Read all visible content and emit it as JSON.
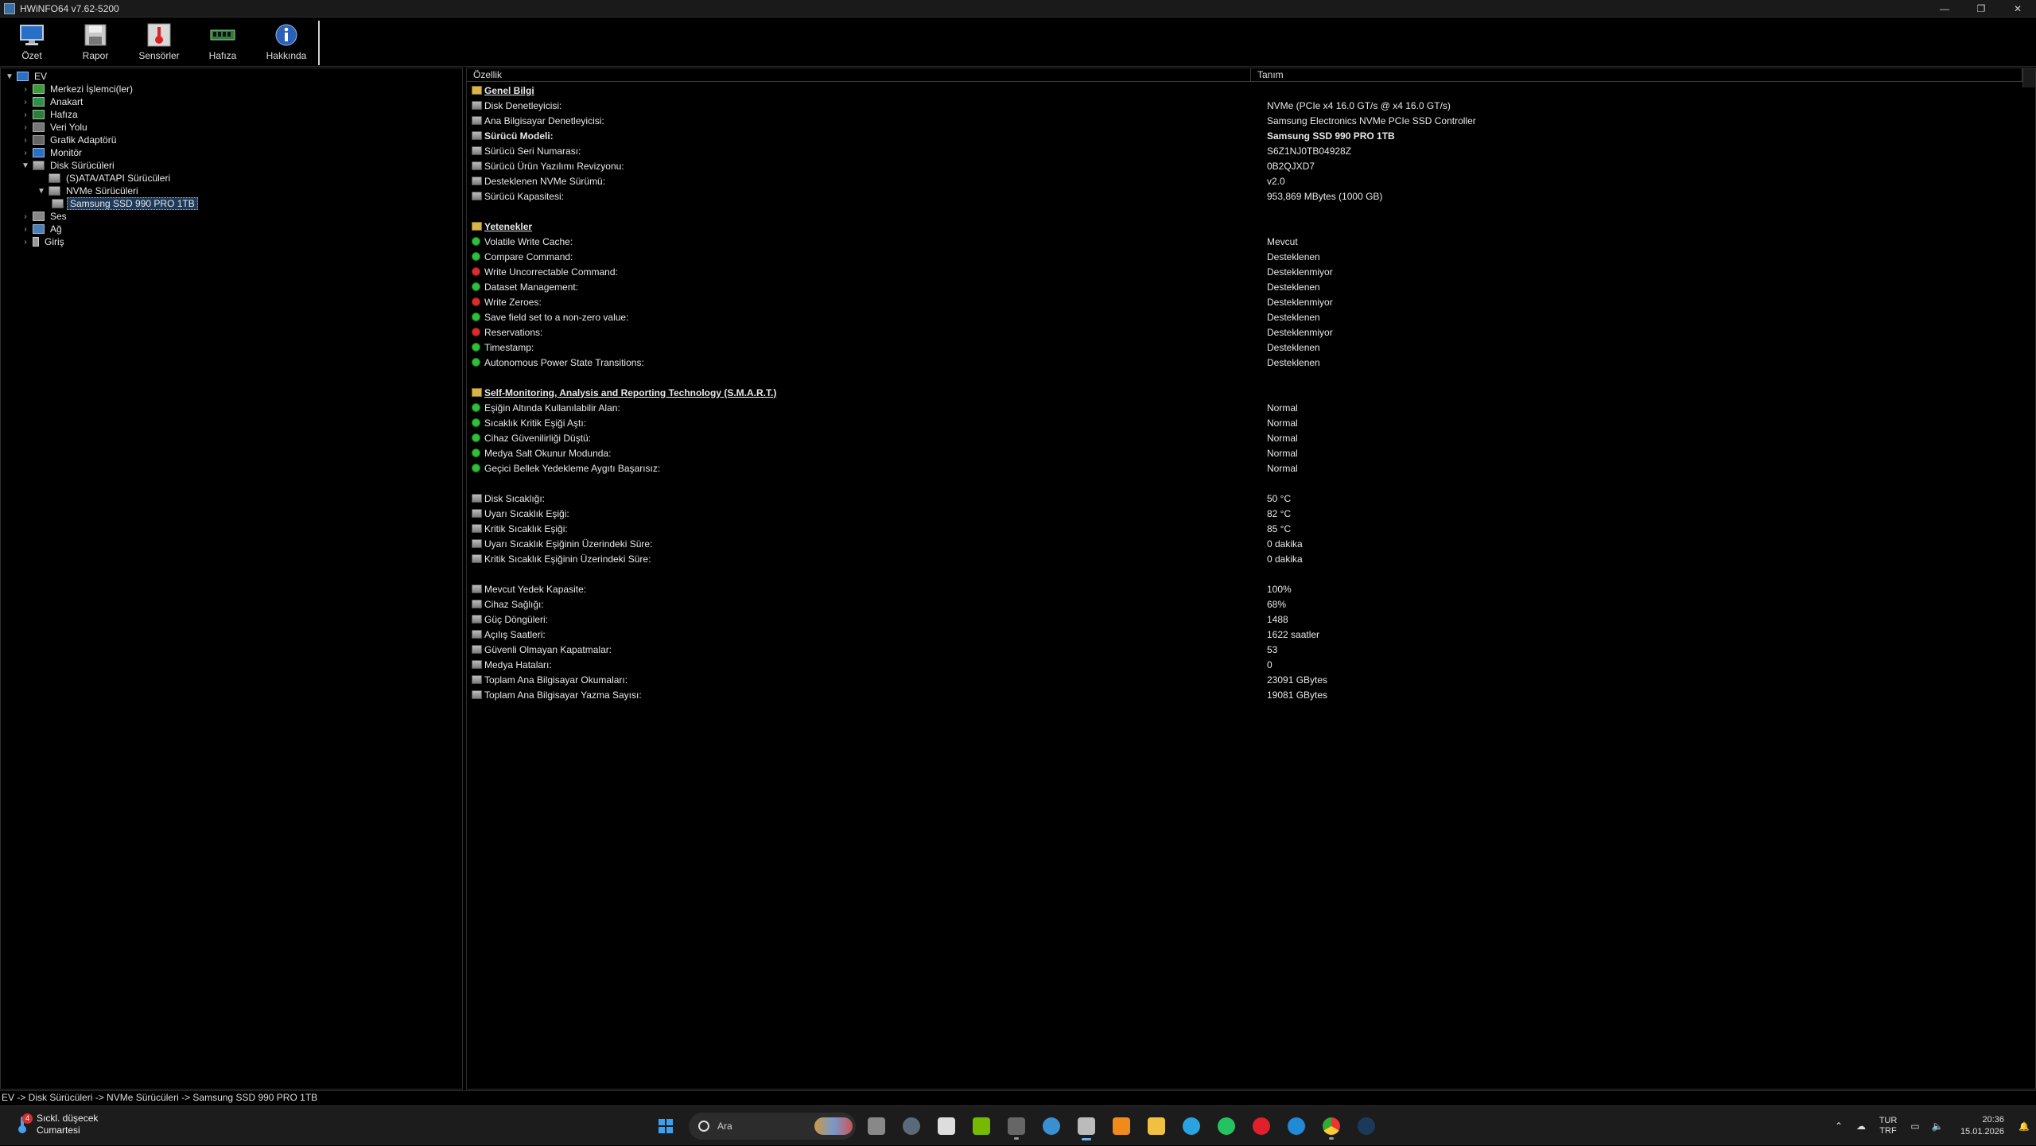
{
  "window": {
    "title": "HWiNFO64 v7.62-5200",
    "buttons": {
      "minimize": "—",
      "restore": "❐",
      "close": "✕"
    }
  },
  "toolbar": {
    "buttons": [
      {
        "label": "Özet",
        "icon": "monitor-icon"
      },
      {
        "label": "Rapor",
        "icon": "save-disk-icon"
      },
      {
        "label": "Sensörler",
        "icon": "thermometer-icon"
      },
      {
        "label": "Hafıza",
        "icon": "memory-module-icon"
      },
      {
        "label": "Hakkında",
        "icon": "info-icon"
      }
    ]
  },
  "tree": {
    "root": "EV",
    "items": [
      {
        "label": "Merkezi İşlemci(ler)"
      },
      {
        "label": "Anakart"
      },
      {
        "label": "Hafıza"
      },
      {
        "label": "Veri Yolu"
      },
      {
        "label": "Grafik Adaptörü"
      },
      {
        "label": "Monitör"
      },
      {
        "label": "Disk Sürücüleri"
      },
      {
        "label": "(S)ATA/ATAPI Sürücüleri"
      },
      {
        "label": "NVMe Sürücüleri"
      },
      {
        "label": "Samsung SSD 990 PRO 1TB"
      },
      {
        "label": "Ses"
      },
      {
        "label": "Ağ"
      },
      {
        "label": "Giriş"
      }
    ]
  },
  "columns": {
    "feature": "Özellik",
    "description": "Tanım"
  },
  "details": [
    {
      "kind": "section",
      "name": "Genel Bilgi",
      "value": ""
    },
    {
      "kind": "drive",
      "name": "Disk Denetleyicisi:",
      "value": "NVMe (PCIe x4 16.0 GT/s @ x4 16.0 GT/s)"
    },
    {
      "kind": "drive",
      "name": "Ana Bilgisayar Denetleyicisi:",
      "value": "Samsung Electronics NVMe PCIe SSD Controller",
      "link": true
    },
    {
      "kind": "drive",
      "name": "Sürücü Modeli:",
      "value": "Samsung SSD 990 PRO 1TB",
      "bold": true
    },
    {
      "kind": "drive",
      "name": "Sürücü Seri Numarası:",
      "value": "S6Z1NJ0TB04928Z"
    },
    {
      "kind": "drive",
      "name": "Sürücü Ürün Yazılımı Revizyonu:",
      "value": "0B2QJXD7"
    },
    {
      "kind": "drive",
      "name": "Desteklenen NVMe Sürümü:",
      "value": "v2.0"
    },
    {
      "kind": "drive",
      "name": "Sürücü Kapasitesi:",
      "value": "953,869 MBytes (1000 GB)"
    },
    {
      "kind": "blank",
      "name": "",
      "value": ""
    },
    {
      "kind": "section",
      "name": "Yetenekler",
      "value": ""
    },
    {
      "kind": "ok",
      "name": "Volatile Write Cache:",
      "value": "Mevcut"
    },
    {
      "kind": "ok",
      "name": "Compare Command:",
      "value": "Desteklenen"
    },
    {
      "kind": "no",
      "name": "Write Uncorrectable Command:",
      "value": "Desteklenmiyor"
    },
    {
      "kind": "ok",
      "name": "Dataset Management:",
      "value": "Desteklenen"
    },
    {
      "kind": "no",
      "name": "Write Zeroes:",
      "value": "Desteklenmiyor"
    },
    {
      "kind": "ok",
      "name": "Save field set to a non-zero value:",
      "value": "Desteklenen"
    },
    {
      "kind": "no",
      "name": "Reservations:",
      "value": "Desteklenmiyor"
    },
    {
      "kind": "ok",
      "name": "Timestamp:",
      "value": "Desteklenen"
    },
    {
      "kind": "ok",
      "name": "Autonomous Power State Transitions:",
      "value": "Desteklenen"
    },
    {
      "kind": "blank",
      "name": "",
      "value": ""
    },
    {
      "kind": "section",
      "name": "Self-Monitoring, Analysis and Reporting Technology (S.M.A.R.T.)",
      "value": ""
    },
    {
      "kind": "ok",
      "name": "Eşiğin Altında Kullanılabilir Alan:",
      "value": "Normal"
    },
    {
      "kind": "ok",
      "name": "Sıcaklık Kritik Eşiği Aştı:",
      "value": "Normal"
    },
    {
      "kind": "ok",
      "name": "Cihaz Güvenilirliği Düştü:",
      "value": "Normal"
    },
    {
      "kind": "ok",
      "name": "Medya Salt Okunur Modunda:",
      "value": "Normal"
    },
    {
      "kind": "ok",
      "name": "Geçici Bellek Yedekleme Aygıtı Başarısız:",
      "value": "Normal"
    },
    {
      "kind": "blank",
      "name": "",
      "value": ""
    },
    {
      "kind": "drive",
      "name": "Disk Sıcaklığı:",
      "value": "50 °C"
    },
    {
      "kind": "drive",
      "name": "Uyarı Sıcaklık Eşiği:",
      "value": "82 °C"
    },
    {
      "kind": "drive",
      "name": "Kritik Sıcaklık Eşiği:",
      "value": "85 °C"
    },
    {
      "kind": "drive",
      "name": "Uyarı Sıcaklık Eşiğinin Üzerindeki Süre:",
      "value": "0 dakika"
    },
    {
      "kind": "drive",
      "name": "Kritik Sıcaklık Eşiğinin Üzerindeki Süre:",
      "value": "0 dakika"
    },
    {
      "kind": "blank",
      "name": "",
      "value": ""
    },
    {
      "kind": "drive",
      "name": "Mevcut Yedek Kapasite:",
      "value": "100%"
    },
    {
      "kind": "drive",
      "name": "Cihaz Sağlığı:",
      "value": "68%"
    },
    {
      "kind": "drive",
      "name": "Güç Döngüleri:",
      "value": "1488"
    },
    {
      "kind": "drive",
      "name": "Açılış Saatleri:",
      "value": "1622 saatler"
    },
    {
      "kind": "drive",
      "name": "Güvenli Olmayan Kapatmalar:",
      "value": "53"
    },
    {
      "kind": "drive",
      "name": "Medya Hataları:",
      "value": "0"
    },
    {
      "kind": "drive",
      "name": "Toplam Ana Bilgisayar Okumaları:",
      "value": "23091 GBytes"
    },
    {
      "kind": "drive",
      "name": "Toplam Ana Bilgisayar Yazma Sayısı:",
      "value": "19081 GBytes"
    }
  ],
  "statusbar": {
    "path": "EV -> Disk Sürücüleri -> NVMe Sürücüleri -> Samsung SSD 990 PRO 1TB"
  },
  "taskbar": {
    "weather": {
      "line1": "Sıckl. düşecek",
      "line2": "Cumartesi",
      "badge": "4"
    },
    "search_placeholder": "Ara",
    "apps": [
      "file-explorer-icon",
      "settings-icon",
      "store-icon",
      "nvidia-icon",
      "app-icon",
      "gear-icon",
      "hwinfo-icon",
      "orange-app-icon",
      "folder-icon",
      "telegram-icon",
      "whatsapp-icon",
      "opera-icon",
      "edge-icon",
      "chrome-icon",
      "steam-icon"
    ],
    "tray": {
      "lang1": "TUR",
      "lang2": "TRF",
      "time": "20:36",
      "date": "15.01.2026"
    }
  },
  "colors": {
    "link": "#5a9bff",
    "ok": "#2fbf3a",
    "no": "#d92d2d",
    "selection": "#1e3a5a"
  }
}
